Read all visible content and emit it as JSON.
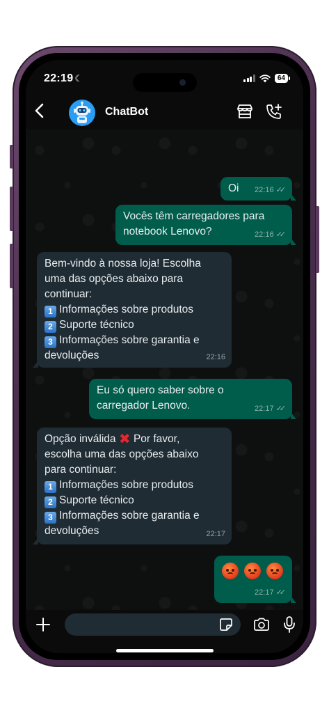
{
  "status": {
    "time": "22:19",
    "battery": "64"
  },
  "header": {
    "contact_name": "ChatBot"
  },
  "messages": [
    {
      "dir": "out",
      "text": "Oi",
      "time": "22:16"
    },
    {
      "dir": "out",
      "lines": [
        "Vocês têm carregadores para",
        "notebook Lenovo?"
      ],
      "time": "22:16"
    },
    {
      "dir": "in",
      "lines": [
        "Bem-vindo à nossa loja! Escolha",
        "uma das opções abaixo para",
        "continuar:"
      ],
      "options": [
        {
          "num": "1",
          "label": "Informações sobre produtos"
        },
        {
          "num": "2",
          "label": "Suporte técnico"
        },
        {
          "num": "3",
          "label": "Informações sobre garantia e"
        }
      ],
      "tail": "devoluções",
      "time": "22:16"
    },
    {
      "dir": "out",
      "lines": [
        "Eu só quero saber sobre o",
        "carregador Lenovo."
      ],
      "time": "22:17"
    },
    {
      "dir": "in",
      "first_line_a": "Opção inválida",
      "first_line_b": "Por favor,",
      "lines": [
        "escolha uma das opções abaixo",
        "para continuar:"
      ],
      "options": [
        {
          "num": "1",
          "label": "Informações sobre produtos"
        },
        {
          "num": "2",
          "label": "Suporte técnico"
        },
        {
          "num": "3",
          "label": "Informações sobre garantia e"
        }
      ],
      "tail": "devoluções",
      "time": "22:17"
    },
    {
      "dir": "out",
      "emoji": [
        "angry-face",
        "angry-face",
        "angry-face"
      ],
      "time": "22:17"
    }
  ],
  "composer": {
    "placeholder": ""
  },
  "colors": {
    "outgoing_bubble": "#005c4b",
    "incoming_bubble": "#1f2c34",
    "header_bg": "#0b0b0b",
    "frame": "#4a2f4d"
  }
}
